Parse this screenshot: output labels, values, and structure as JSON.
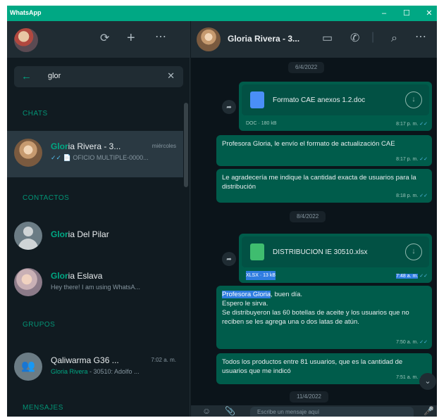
{
  "window": {
    "title": "WhatsApp",
    "minimize_glyph": "–",
    "maximize_glyph": "☐",
    "close_glyph": "✕"
  },
  "left_header": {
    "icons": [
      "new-status-icon",
      "new-chat-icon",
      "menu-icon"
    ]
  },
  "search": {
    "query": "glor",
    "back_icon": "arrow-back-icon",
    "clear_icon": "close-icon"
  },
  "sections": {
    "chats": "CHATS",
    "contacts": "CONTACTOS",
    "groups": "GRUPOS",
    "messages": "MENSAJES"
  },
  "chats": [
    {
      "name_match": "Glor",
      "name_rest": "ia Rivera - 3...",
      "time": "miércoles",
      "preview_tick": "✓✓",
      "preview_text": "📄 OFICIO MULTIPLE-0000..."
    }
  ],
  "contacts": [
    {
      "name_match": "Glor",
      "name_rest": "ia Del Pilar",
      "status": ""
    },
    {
      "name_match": "Glor",
      "name_rest": "ia Eslava",
      "status": "Hey there! I am using WhatsA..."
    }
  ],
  "groups": [
    {
      "name": "Qaliwarma G36 ...",
      "time": "7:02 a. m.",
      "preview_match": "Gloria Rivera",
      "preview_rest": " - 30510: Adolfo ..."
    }
  ],
  "conversation": {
    "contact_name": "Gloria Rivera - 3...",
    "header_icons": [
      "video-call-icon",
      "phone-icon",
      "search-icon",
      "menu-icon"
    ],
    "dates": [
      "6/4/2022",
      "8/4/2022",
      "11/4/2022"
    ],
    "doc1": {
      "filename": "Formato CAE anexos 1.2.doc",
      "info": "DOC · 180 kB",
      "time": "8:17 p. m."
    },
    "msg1": {
      "text": "Profesora Gloria, le envío el formato de actualización CAE",
      "time": "8:17 p. m."
    },
    "msg2": {
      "text": "Le agradecería me indique la cantidad exacta de usuarios para la distribución",
      "time": "8:18 p. m."
    },
    "doc2": {
      "filename": "DISTRIBUCION IE 30510.xlsx",
      "info": "XLSX · 13 kB",
      "time": "7:48 a. m."
    },
    "msg3": {
      "highlight": "Profesora Gloria",
      "line1_rest": ", buen día.",
      "line2": "Espero le sirva.",
      "line3": "Se distribuyeron las 60 botellas de aceite y los usuarios que no reciben se les agrega una o dos latas de atún.",
      "time": "7:50 a. m."
    },
    "msg4": {
      "text": "Todos los productos entre 81 usuarios, que es la cantidad de usuarios que me indicó",
      "time": "7:51 a. m."
    },
    "composer_placeholder": "Escribe un mensaje aquí"
  }
}
